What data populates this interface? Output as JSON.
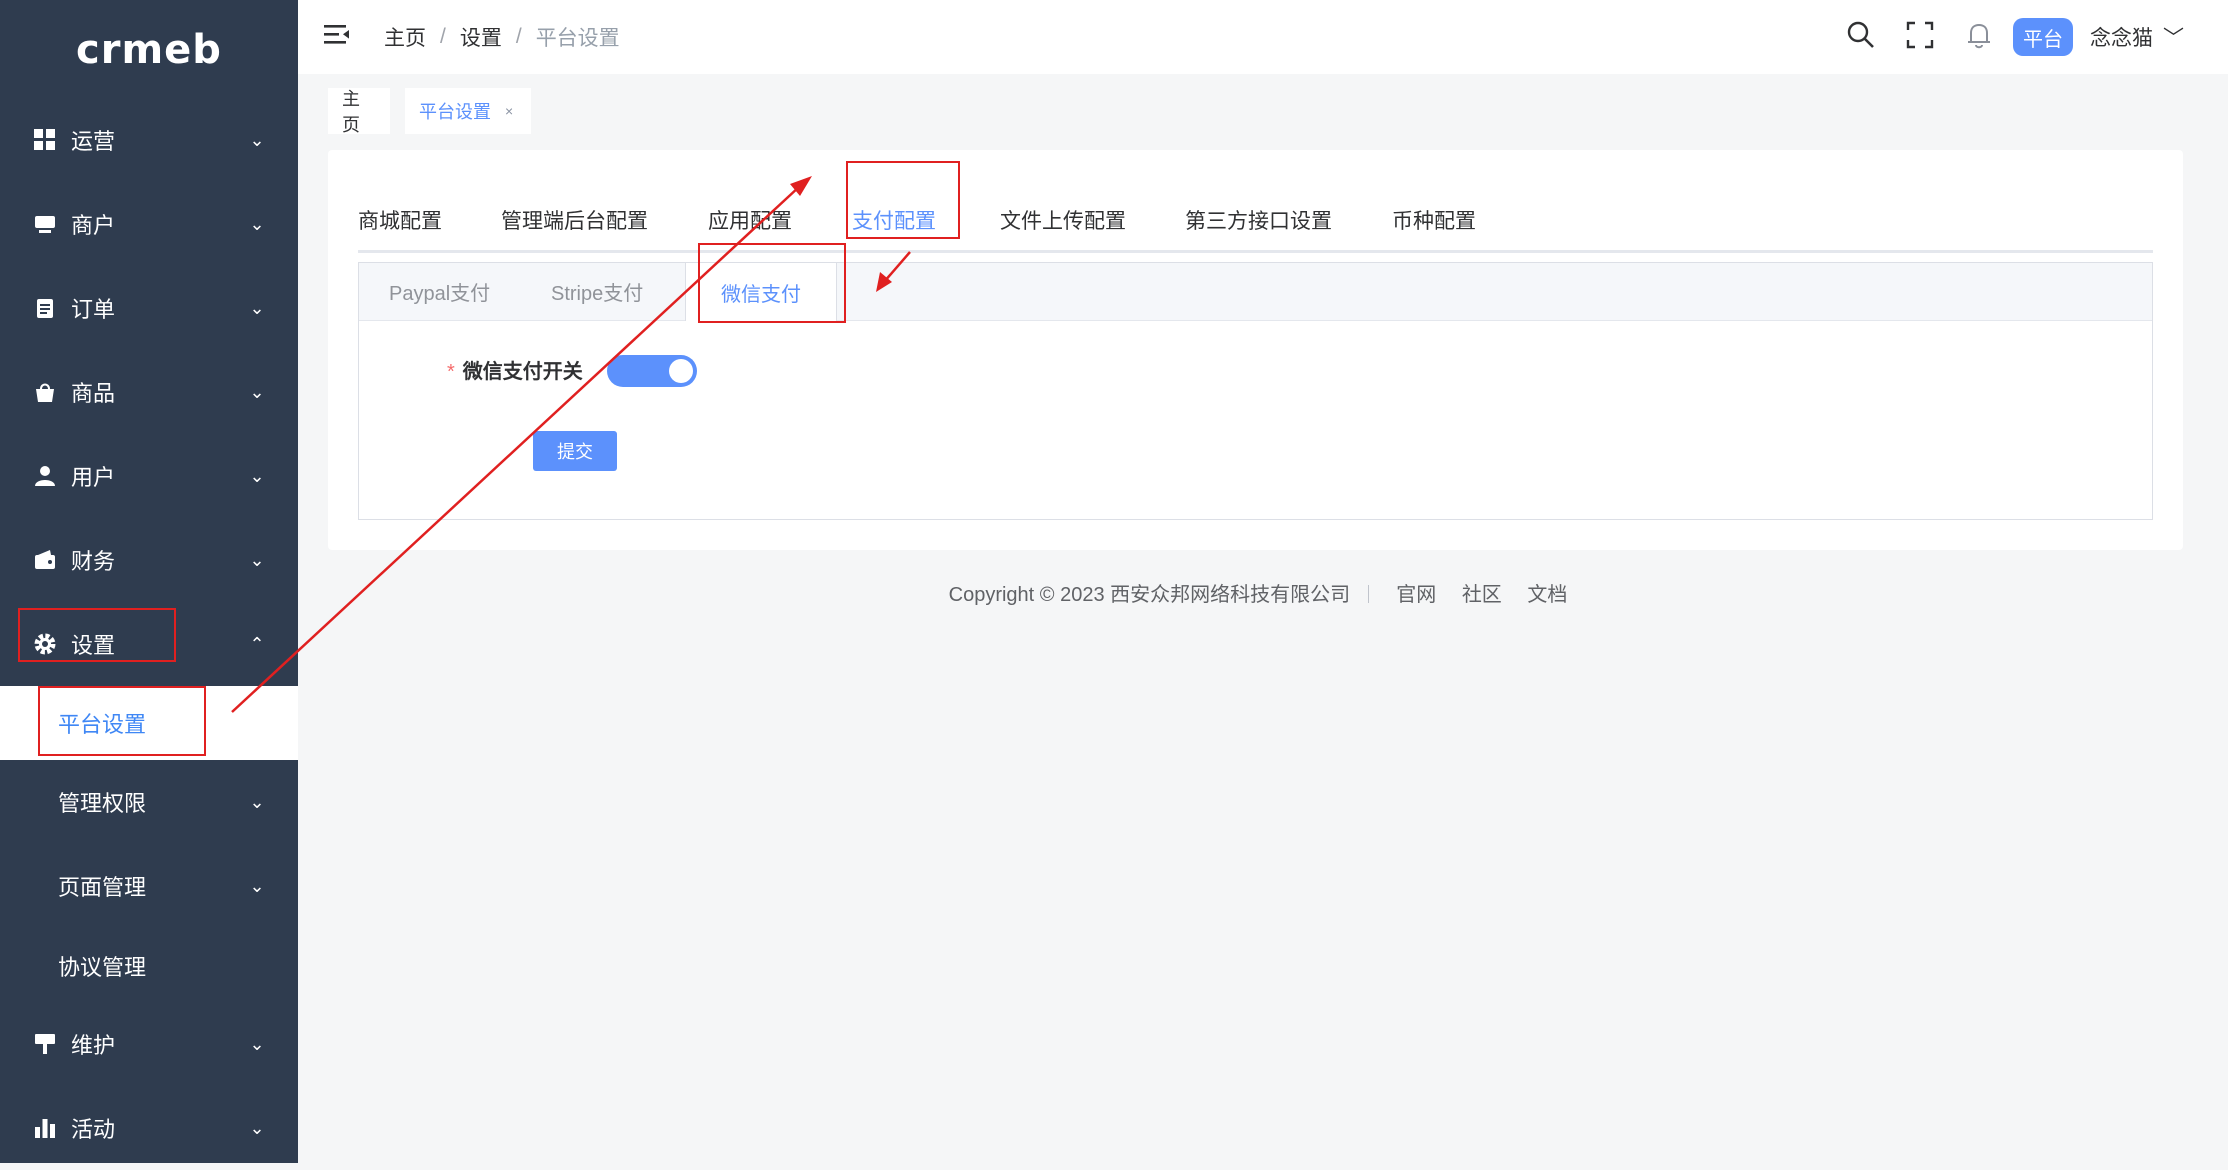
{
  "sidebar": {
    "logo": "crmeb",
    "items": [
      {
        "label": "运营",
        "icon": "grid-icon",
        "chev": "⌄"
      },
      {
        "label": "商户",
        "icon": "store-icon",
        "chev": "⌄"
      },
      {
        "label": "订单",
        "icon": "clipboard-icon",
        "chev": "⌄"
      },
      {
        "label": "商品",
        "icon": "bag-icon",
        "chev": "⌄"
      },
      {
        "label": "用户",
        "icon": "user-icon",
        "chev": "⌄"
      },
      {
        "label": "财务",
        "icon": "wallet-icon",
        "chev": "⌄"
      },
      {
        "label": "设置",
        "icon": "gear-icon",
        "chev": "⌃"
      },
      {
        "label": "平台设置"
      },
      {
        "label": "管理权限",
        "chev": "⌄"
      },
      {
        "label": "页面管理",
        "chev": "⌄"
      },
      {
        "label": "协议管理"
      },
      {
        "label": "维护",
        "icon": "brush-icon",
        "chev": "⌄"
      },
      {
        "label": "活动",
        "icon": "bar-chart-icon",
        "chev": "⌄"
      }
    ]
  },
  "header": {
    "breadcrumb": [
      "主页",
      "设置",
      "平台设置"
    ],
    "separator": "/",
    "role_badge": "平台",
    "username": "念念猫",
    "caret": "﹀"
  },
  "page_tabs": [
    {
      "label": "主页"
    },
    {
      "label": "平台设置",
      "close": "×"
    }
  ],
  "config_tabs": [
    "商城配置",
    "管理端后台配置",
    "应用配置",
    "支付配置",
    "文件上传配置",
    "第三方接口设置",
    "币种配置"
  ],
  "payment_tabs": [
    "Paypal支付",
    "Stripe支付",
    "微信支付"
  ],
  "form": {
    "required_mark": "*",
    "switch_label": "微信支付开关",
    "switch_on": true,
    "submit_label": "提交"
  },
  "footer": {
    "copyright": "Copyright © 2023 西安众邦网络科技有限公司",
    "links": [
      "官网",
      "社区",
      "文档"
    ]
  },
  "colors": {
    "sidebar_bg": "#2f3c4f",
    "accent": "#5c91fc",
    "annotation": "#e02020"
  }
}
